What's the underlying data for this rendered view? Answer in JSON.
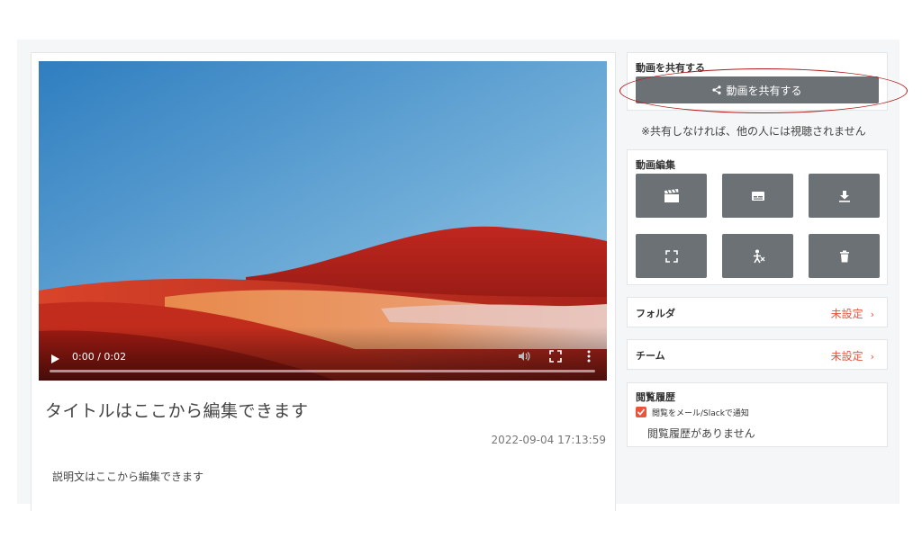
{
  "video": {
    "time": "0:00 / 0:02",
    "progress": 0
  },
  "content": {
    "title": "タイトルはここから編集できます",
    "timestamp": "2022-09-04 17:13:59",
    "description": "説明文はここから編集できます"
  },
  "share": {
    "heading": "動画を共有する",
    "button_label": "動画を共有する",
    "note": "※共有しなければ、他の人には視聴されません"
  },
  "edit": {
    "heading": "動画編集",
    "tools": [
      "clapper-icon",
      "subtitle-icon",
      "download-icon",
      "crop-icon",
      "cut-person-icon",
      "trash-icon"
    ]
  },
  "folder": {
    "label": "フォルダ",
    "value": "未設定",
    "chevron": "›"
  },
  "team": {
    "label": "チーム",
    "value": "未設定",
    "chevron": "›"
  },
  "history": {
    "heading": "閲覧履歴",
    "notify_label": "閲覧をメール/Slackで通知",
    "notify_checked": true,
    "empty": "閲覧履歴がありません"
  },
  "colors": {
    "accent": "#e8553a",
    "button_gray": "#6c7176",
    "highlight_ring": "#b21a1a"
  }
}
